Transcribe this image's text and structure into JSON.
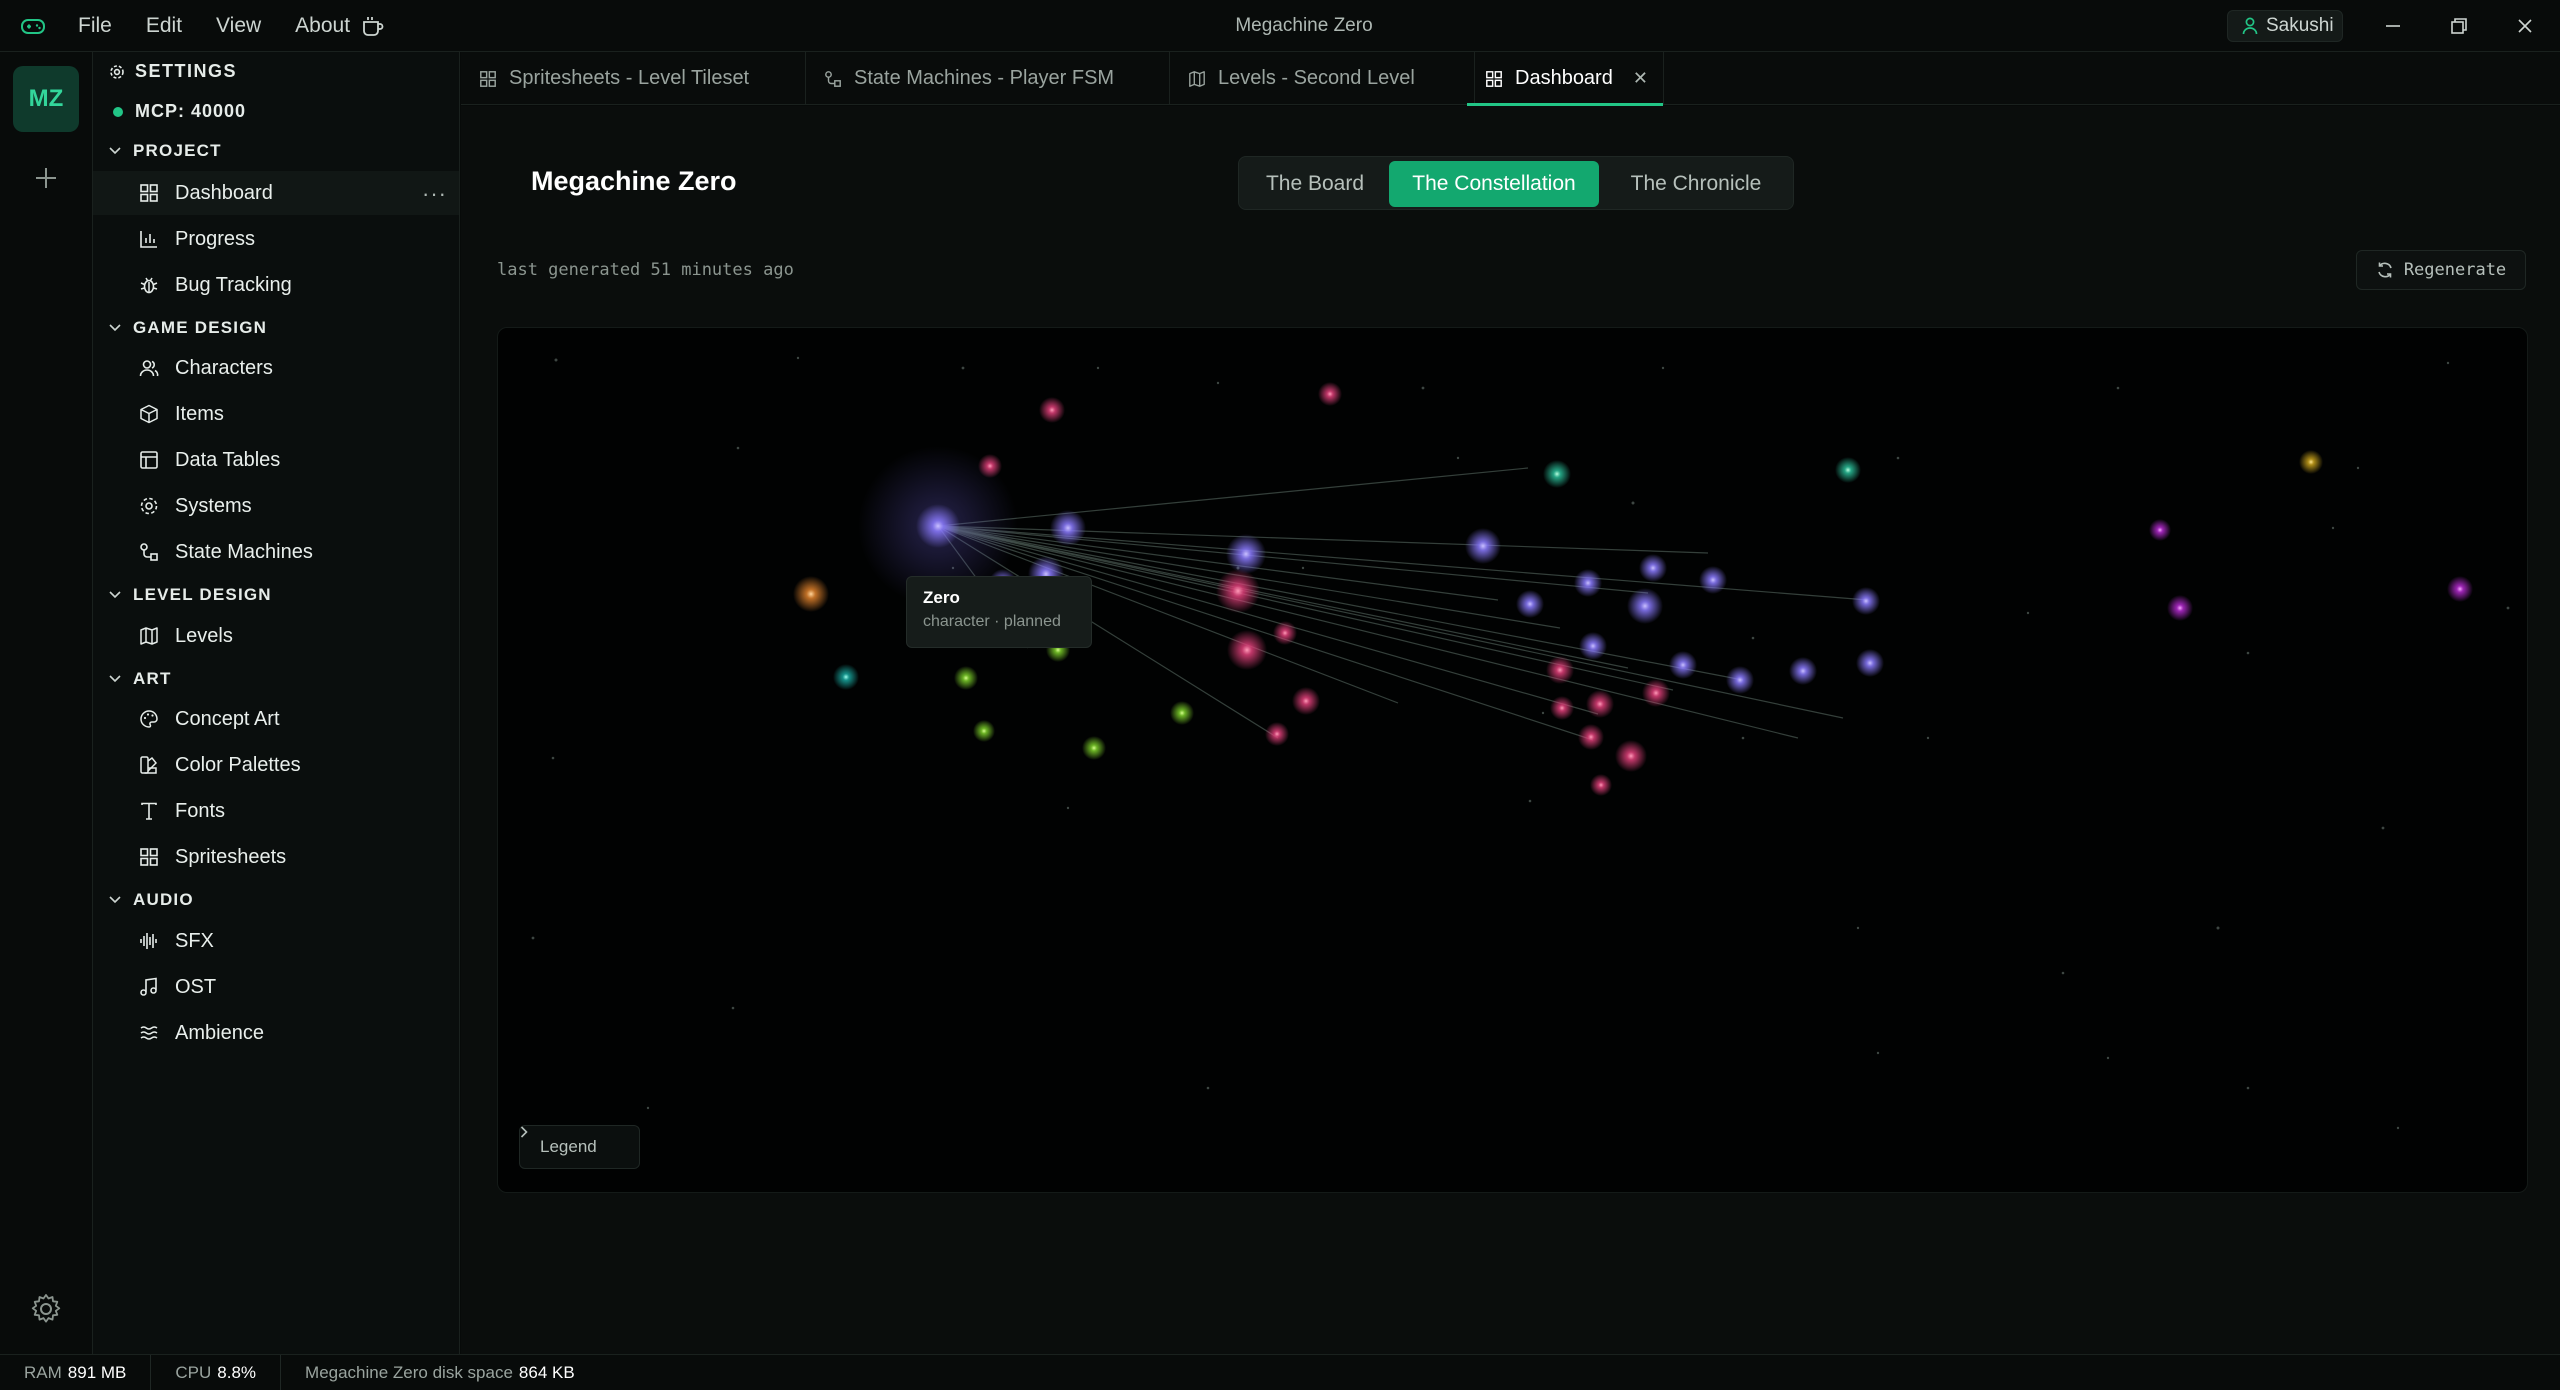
{
  "app": {
    "title": "Megachine Zero",
    "menu": [
      "File",
      "Edit",
      "View",
      "About"
    ],
    "user": "Sakushi"
  },
  "rail": {
    "avatar": "MZ"
  },
  "sidebar": {
    "settings": "SETTINGS",
    "mcp": "MCP: 40000",
    "sections": {
      "project": {
        "label": "PROJECT",
        "items": [
          {
            "label": "Dashboard",
            "icon": "dashboard-icon",
            "active": true
          },
          {
            "label": "Progress",
            "icon": "progress-icon"
          },
          {
            "label": "Bug Tracking",
            "icon": "bug-icon"
          }
        ]
      },
      "game_design": {
        "label": "GAME DESIGN",
        "items": [
          {
            "label": "Characters",
            "icon": "characters-icon"
          },
          {
            "label": "Items",
            "icon": "items-icon"
          },
          {
            "label": "Data Tables",
            "icon": "table-icon"
          },
          {
            "label": "Systems",
            "icon": "systems-icon"
          },
          {
            "label": "State Machines",
            "icon": "state-machine-icon"
          }
        ]
      },
      "level_design": {
        "label": "LEVEL DESIGN",
        "items": [
          {
            "label": "Levels",
            "icon": "map-icon"
          }
        ]
      },
      "art": {
        "label": "ART",
        "items": [
          {
            "label": "Concept Art",
            "icon": "palette-icon"
          },
          {
            "label": "Color Palettes",
            "icon": "swatch-icon"
          },
          {
            "label": "Fonts",
            "icon": "type-icon"
          },
          {
            "label": "Spritesheets",
            "icon": "grid-icon"
          }
        ]
      },
      "audio": {
        "label": "AUDIO",
        "items": [
          {
            "label": "SFX",
            "icon": "waveform-icon"
          },
          {
            "label": "OST",
            "icon": "music-icon"
          },
          {
            "label": "Ambience",
            "icon": "waves-icon"
          }
        ]
      }
    }
  },
  "tabs": [
    {
      "label": "Spritesheets - Level Tileset",
      "icon": "grid-icon"
    },
    {
      "label": "State Machines - Player FSM",
      "icon": "state-machine-icon"
    },
    {
      "label": "Levels - Second Level",
      "icon": "map-icon"
    },
    {
      "label": "Dashboard",
      "icon": "dashboard-icon",
      "active": true
    }
  ],
  "main": {
    "title": "Megachine Zero",
    "views": [
      "The Board",
      "The Constellation",
      "The Chronicle"
    ],
    "active_view": "The Constellation",
    "generated": "last generated 51 minutes ago",
    "regenerate": "Regenerate",
    "tooltip": {
      "title": "Zero",
      "subtitle": "character · planned"
    },
    "legend": "Legend"
  },
  "colors": {
    "accent": "#13a86f",
    "character": "#8b7bff",
    "item": "#e0407a",
    "system": "#7ccf2a",
    "level": "#2bbf9a"
  },
  "status": {
    "ram_label": "RAM",
    "ram": "891 MB",
    "cpu_label": "CPU",
    "cpu": "8.8%",
    "disk_label": "Megachine Zero disk space",
    "disk": "864 KB"
  }
}
